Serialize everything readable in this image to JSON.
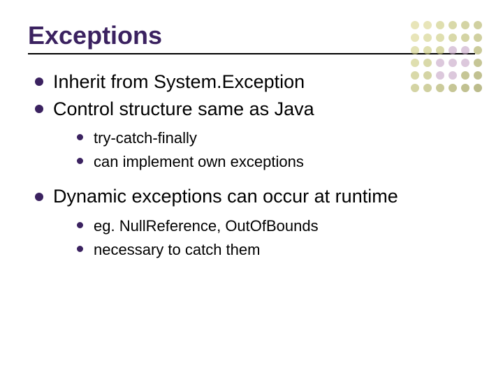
{
  "title": "Exceptions",
  "bullets": {
    "b1": "Inherit from System.Exception",
    "b2": "Control structure same as Java",
    "b2_sub1": "try-catch-finally",
    "b2_sub2": "can implement own exceptions",
    "b3": "Dynamic exceptions can occur at runtime",
    "b3_sub1": "eg. NullReference, OutOfBounds",
    "b3_sub2": "necessary to catch them"
  },
  "decor": {
    "dot_colors": [
      "#d9d48a",
      "#d9d48a",
      "#c9c97a",
      "#c0c070",
      "#b8b868",
      "#b0b060",
      "#d9d48a",
      "#d1cf82",
      "#c9c97a",
      "#c0c070",
      "#b8b868",
      "#b0b060",
      "#d1cf82",
      "#c9c97a",
      "#c0c070",
      "#c4a4c4",
      "#c4a4c4",
      "#a8a858",
      "#c9c97a",
      "#c0c070",
      "#c4a4c4",
      "#c4a4c4",
      "#c4a4c4",
      "#a0a050",
      "#c0c070",
      "#b8b868",
      "#c4a4c4",
      "#c4a4c4",
      "#a0a050",
      "#989848",
      "#b8b868",
      "#b0b060",
      "#a8a858",
      "#a0a050",
      "#989848",
      "#909040"
    ]
  }
}
